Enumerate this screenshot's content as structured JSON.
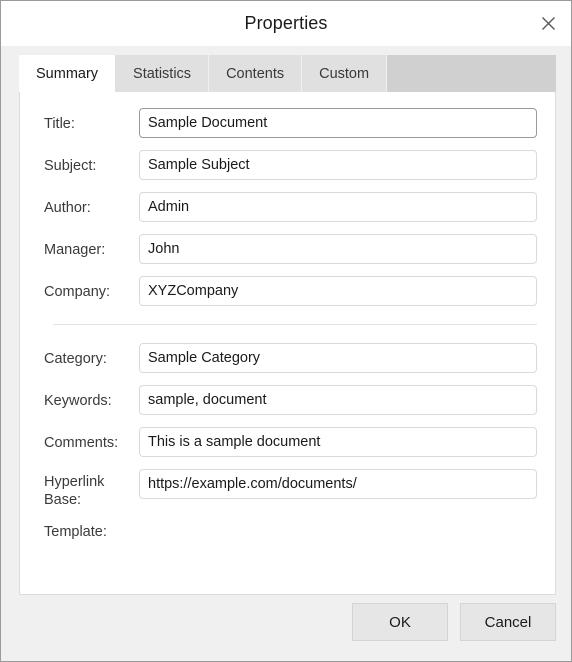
{
  "dialog": {
    "title": "Properties",
    "close_icon": "close-icon"
  },
  "tabs": [
    {
      "label": "Summary",
      "active": true
    },
    {
      "label": "Statistics",
      "active": false
    },
    {
      "label": "Contents",
      "active": false
    },
    {
      "label": "Custom",
      "active": false
    }
  ],
  "summary": {
    "group_one": [
      {
        "label": "Title:",
        "value": "Sample Document",
        "placeholder": "",
        "emphasized": true
      },
      {
        "label": "Subject:",
        "value": "Sample Subject",
        "placeholder": "",
        "emphasized": false
      },
      {
        "label": "Author:",
        "value": "Admin",
        "placeholder": "",
        "emphasized": false
      },
      {
        "label": "Manager:",
        "value": "John",
        "placeholder": "",
        "emphasized": false
      },
      {
        "label": "Company:",
        "value": "XYZCompany",
        "placeholder": "",
        "emphasized": false
      }
    ],
    "group_two": [
      {
        "label": "Category:",
        "value": "Sample Category",
        "placeholder": "",
        "emphasized": false
      },
      {
        "label": "Keywords:",
        "value": "sample, document",
        "placeholder": "",
        "emphasized": false
      },
      {
        "label": "Comments:",
        "value": "This is a sample document",
        "placeholder": "",
        "emphasized": false
      }
    ],
    "hyperlink": {
      "label": "Hyperlink Base:",
      "value": "https://example.com/documents/",
      "placeholder": ""
    },
    "template": {
      "label": "Template:",
      "value": ""
    }
  },
  "footer": {
    "ok_label": "OK",
    "cancel_label": "Cancel"
  },
  "colors": {
    "panel_bg": "#ffffff",
    "dialog_bg": "#f0f0f0",
    "tab_inactive": "#e0e0e0",
    "tab_strip_filler": "#d0d0d0",
    "input_border": "#dadada",
    "button_bg": "#e6e6e6"
  }
}
